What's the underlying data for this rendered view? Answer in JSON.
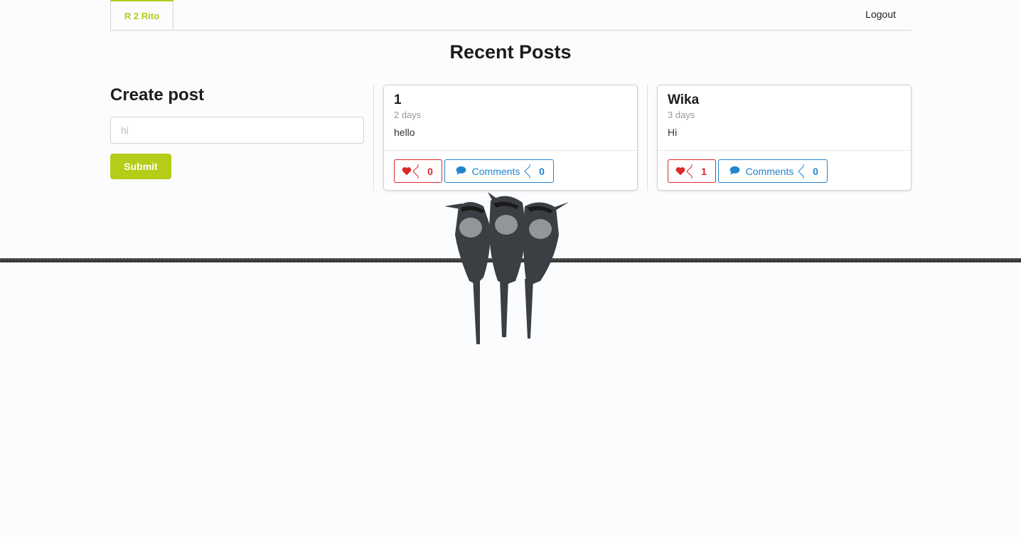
{
  "nav": {
    "brand": "R 2 Rito",
    "logout": "Logout"
  },
  "page_title": "Recent Posts",
  "create_post": {
    "heading": "Create post",
    "input_value": "hi",
    "submit_label": "Submit"
  },
  "posts": [
    {
      "title": "1",
      "age": "2 days",
      "body": "hello",
      "likes": "0",
      "comments_label": "Comments",
      "comments": "0"
    },
    {
      "title": "Wika",
      "age": "3 days",
      "body": "Hi",
      "likes": "1",
      "comments_label": "Comments",
      "comments": "0"
    }
  ],
  "colors": {
    "accent": "#b5cc18",
    "like": "#db2828",
    "comment": "#2185d0"
  },
  "icons": {
    "like": "heart-icon",
    "comment": "comment-icon"
  }
}
